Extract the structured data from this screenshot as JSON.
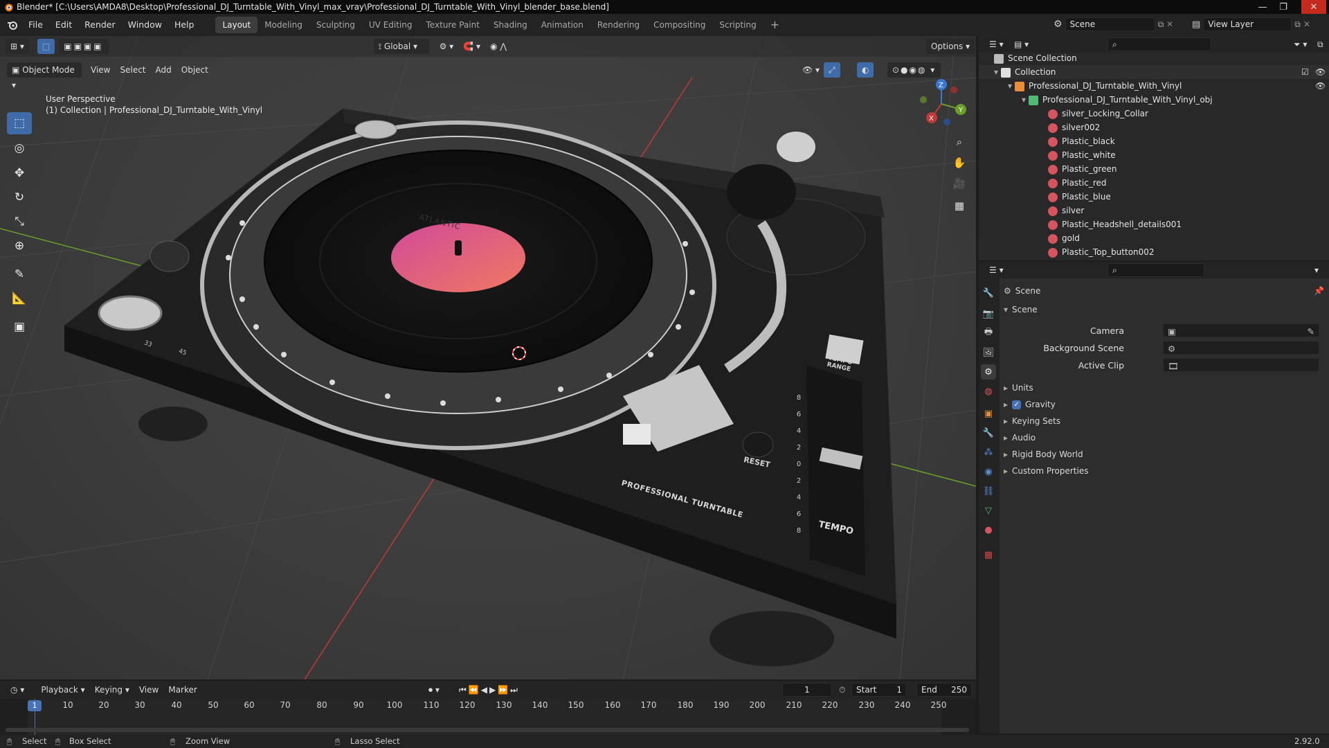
{
  "window": {
    "title": "Blender* [C:\\Users\\AMDA8\\Desktop\\Professional_DJ_Turntable_With_Vinyl_max_vray\\Professional_DJ_Turntable_With_Vinyl_blender_base.blend]",
    "controls": [
      "—",
      "❐",
      "✕"
    ]
  },
  "menus": [
    "File",
    "Edit",
    "Render",
    "Window",
    "Help"
  ],
  "workspaces": [
    "Layout",
    "Modeling",
    "Sculpting",
    "UV Editing",
    "Texture Paint",
    "Shading",
    "Animation",
    "Rendering",
    "Compositing",
    "Scripting"
  ],
  "add_workspace": "+",
  "scene_selector": {
    "value": "Scene"
  },
  "view_layer_selector": {
    "value": "View Layer"
  },
  "tool_header": {
    "transform_orientation": "Global",
    "options_label": "Options"
  },
  "viewport_header": {
    "mode": "Object Mode",
    "menus": [
      "View",
      "Select",
      "Add",
      "Object"
    ]
  },
  "viewport_overlay": {
    "line1": "User Perspective",
    "line2": "(1) Collection | Professional_DJ_Turntable_With_Vinyl"
  },
  "gizmo": {
    "x": "X",
    "y": "Y",
    "z": "Z"
  },
  "toolbar_tools": [
    {
      "name": "select-box-tool",
      "glyph": "⬚",
      "active": true
    },
    {
      "name": "cursor-tool",
      "glyph": "◎"
    },
    {
      "name": "move-tool",
      "glyph": "✥"
    },
    {
      "name": "rotate-tool",
      "glyph": "↻"
    },
    {
      "name": "scale-tool",
      "glyph": "⤡"
    },
    {
      "name": "transform-tool",
      "glyph": "⊕"
    },
    {
      "name": "annotate-tool",
      "glyph": "✎"
    },
    {
      "name": "measure-tool",
      "glyph": "📐"
    },
    {
      "name": "add-cube-tool",
      "glyph": "▣"
    }
  ],
  "model_labels": {
    "record_label": "ATLANTIC",
    "reset": "RESET",
    "tempo": "TEMPO",
    "tempo_range": "TEMPO RANGE",
    "brand": "PROFESSIONAL TURNTABLE",
    "speed_33": "33",
    "speed_45": "45",
    "pitch_scale": [
      "8",
      "6",
      "4",
      "2",
      "0",
      "2",
      "4",
      "6",
      "8"
    ]
  },
  "outliner": {
    "root": "Scene Collection",
    "collection": "Collection",
    "object": "Professional_DJ_Turntable_With_Vinyl",
    "mesh": "Professional_DJ_Turntable_With_Vinyl_obj",
    "materials": [
      "silver_Locking_Collar",
      "silver002",
      "Plastic_black",
      "Plastic_white",
      "Plastic_green",
      "Plastic_red",
      "Plastic_blue",
      "silver",
      "Plastic_Headshell_details001",
      "gold",
      "Plastic_Top_button002"
    ]
  },
  "properties": {
    "context": "Scene",
    "panel": "Scene",
    "fields": [
      {
        "label": "Camera"
      },
      {
        "label": "Background Scene"
      },
      {
        "label": "Active Clip"
      }
    ],
    "subpanels": [
      "Units",
      "Gravity",
      "Keying Sets",
      "Audio",
      "Rigid Body World",
      "Custom Properties"
    ],
    "gravity_checked": true
  },
  "timeline": {
    "menus": [
      "Playback",
      "Keying",
      "View",
      "Marker"
    ],
    "current_frame": "1",
    "start_label": "Start",
    "start": "1",
    "end_label": "End",
    "end": "250",
    "ticks": [
      "1",
      "10",
      "20",
      "30",
      "40",
      "50",
      "60",
      "70",
      "80",
      "90",
      "100",
      "110",
      "120",
      "130",
      "140",
      "150",
      "160",
      "170",
      "180",
      "190",
      "200",
      "210",
      "220",
      "230",
      "240",
      "250"
    ]
  },
  "statusbar": {
    "select": "Select",
    "box_select": "Box Select",
    "zoom_view": "Zoom View",
    "lasso_select": "Lasso Select",
    "version": "2.92.0"
  },
  "colors": {
    "accent": "#3f6ba8",
    "header": "#232323",
    "viewport_bg": "#3d3d3d",
    "axis_x": "#c03a3a",
    "axis_y": "#6aa02a",
    "axis_z": "#3a78d8",
    "record_label": "#e86a8a"
  }
}
